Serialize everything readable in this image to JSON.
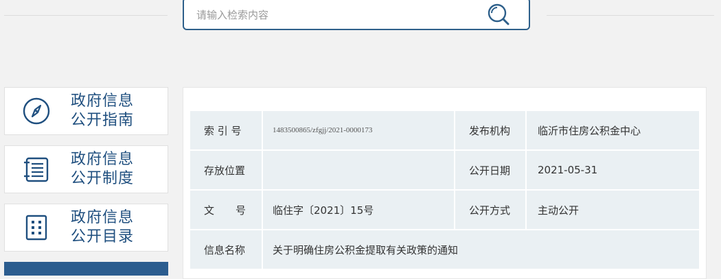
{
  "search": {
    "placeholder": "请输入检索内容"
  },
  "sidebar": {
    "items": [
      {
        "line1": "政府信息",
        "line2": "公开指南",
        "icon": "compass-icon"
      },
      {
        "line1": "政府信息",
        "line2": "公开制度",
        "icon": "list-document-icon"
      },
      {
        "line1": "政府信息",
        "line2": "公开目录",
        "icon": "grid-catalog-icon"
      }
    ]
  },
  "info": {
    "index_label": "索 引 号",
    "index_value": "1483500865/zfgjj/2021-0000173",
    "publisher_label": "发布机构",
    "publisher_value": "临沂市住房公积金中心",
    "location_label": "存放位置",
    "location_value": "",
    "date_label": "公开日期",
    "date_value": "2021-05-31",
    "docno_label": "文　号",
    "docno_value": "临住字〔2021〕15号",
    "method_label": "公开方式",
    "method_value": "主动公开",
    "title_label": "信息名称",
    "title_value": "关于明确住房公积金提取有关政策的通知"
  },
  "colors": {
    "accent": "#2d5f8a",
    "cell_bg": "#eaf0f3",
    "label": "#1f4f7f"
  }
}
